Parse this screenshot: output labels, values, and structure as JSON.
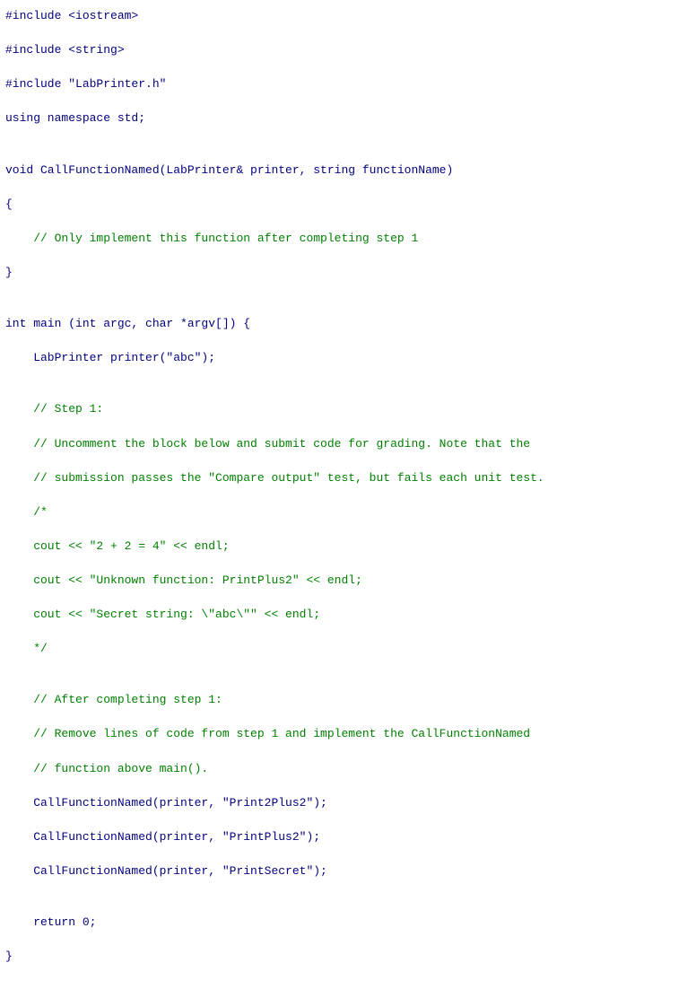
{
  "code": {
    "lines": [
      {
        "text": "#include <iostream>",
        "type": "normal"
      },
      {
        "text": "#include <string>",
        "type": "normal"
      },
      {
        "text": "#include \"LabPrinter.h\"",
        "type": "normal"
      },
      {
        "text": "using namespace std;",
        "type": "normal"
      },
      {
        "text": "",
        "type": "empty"
      },
      {
        "text": "void CallFunctionNamed(LabPrinter& printer, string functionName)",
        "type": "normal"
      },
      {
        "text": "{",
        "type": "normal"
      },
      {
        "text": "    // Only implement this function after completing step 1",
        "type": "comment"
      },
      {
        "text": "}",
        "type": "normal"
      },
      {
        "text": "",
        "type": "empty"
      },
      {
        "text": "int main (int argc, char *argv[]) {",
        "type": "normal"
      },
      {
        "text": "    LabPrinter printer(\"abc\");",
        "type": "normal"
      },
      {
        "text": "",
        "type": "empty"
      },
      {
        "text": "    // Step 1:",
        "type": "comment"
      },
      {
        "text": "    // Uncomment the block below and submit code for grading. Note that the",
        "type": "comment"
      },
      {
        "text": "    // submission passes the \"Compare output\" test, but fails each unit test.",
        "type": "comment"
      },
      {
        "text": "    /*",
        "type": "comment"
      },
      {
        "text": "    cout << \"2 + 2 = 4\" << endl;",
        "type": "comment"
      },
      {
        "text": "    cout << \"Unknown function: PrintPlus2\" << endl;",
        "type": "comment"
      },
      {
        "text": "    cout << \"Secret string: \\\"abc\\\"\" << endl;",
        "type": "comment"
      },
      {
        "text": "    */",
        "type": "comment"
      },
      {
        "text": "",
        "type": "empty"
      },
      {
        "text": "    // After completing step 1:",
        "type": "comment"
      },
      {
        "text": "    // Remove lines of code from step 1 and implement the CallFunctionNamed",
        "type": "comment"
      },
      {
        "text": "    // function above main().",
        "type": "comment"
      },
      {
        "text": "    CallFunctionNamed(printer, \"Print2Plus2\");",
        "type": "normal"
      },
      {
        "text": "    CallFunctionNamed(printer, \"PrintPlus2\");",
        "type": "normal"
      },
      {
        "text": "    CallFunctionNamed(printer, \"PrintSecret\");",
        "type": "normal"
      },
      {
        "text": "",
        "type": "empty"
      },
      {
        "text": "    return 0;",
        "type": "normal"
      },
      {
        "text": "}",
        "type": "normal"
      }
    ]
  }
}
